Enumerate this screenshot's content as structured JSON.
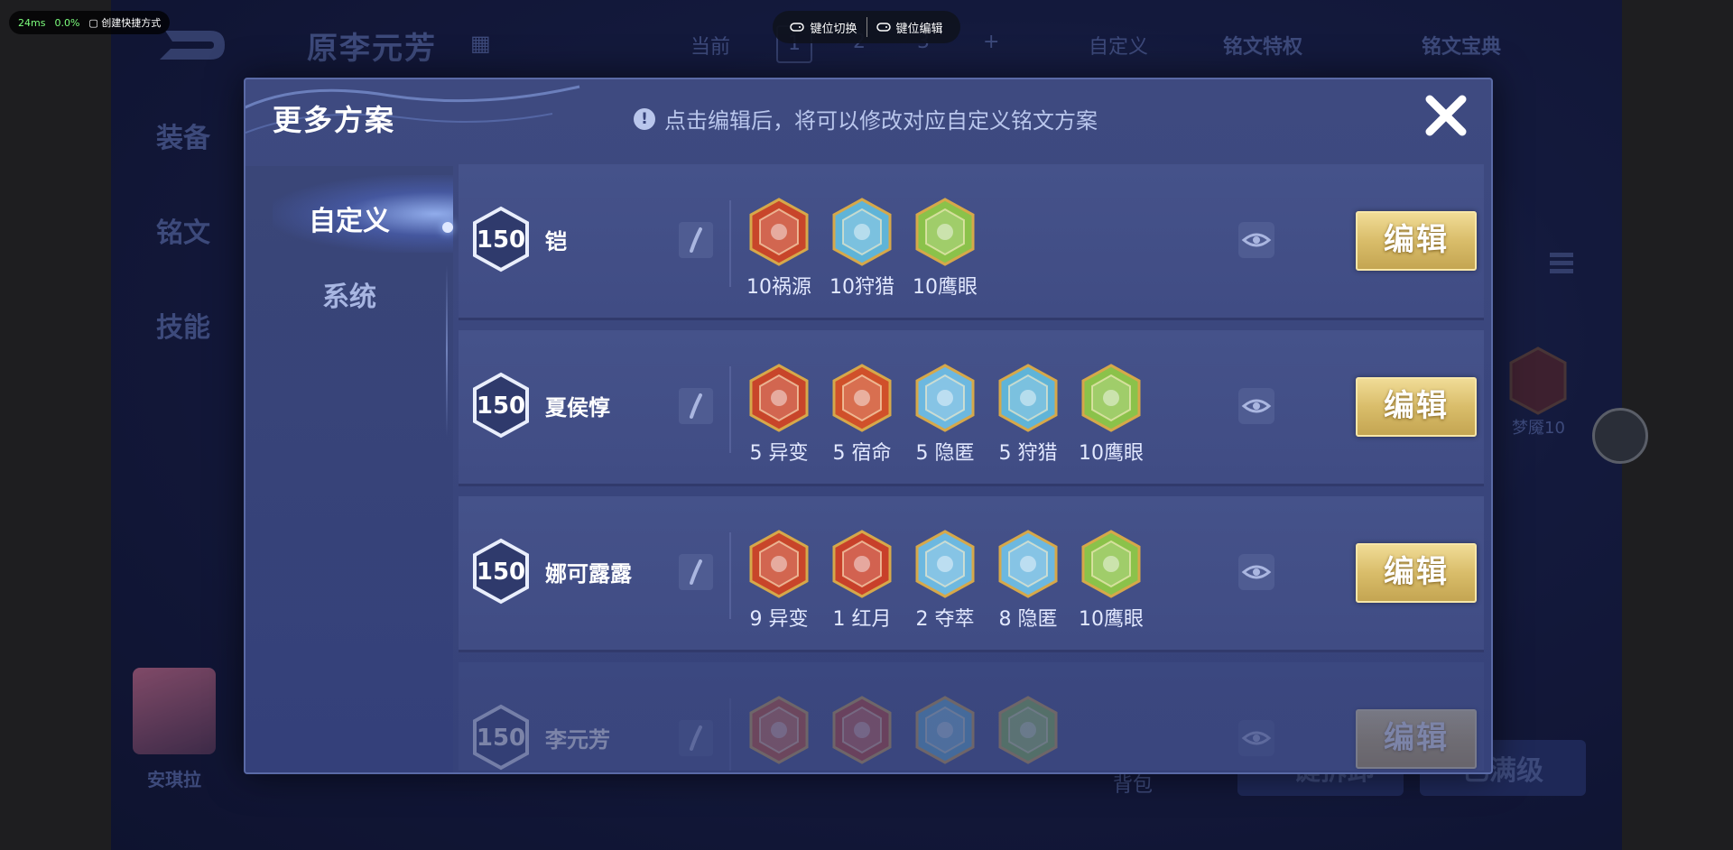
{
  "overlay": {
    "latency": "24ms",
    "cpu": "0.0%",
    "shortcut_label": "创建快捷方式",
    "key_switch": "键位切换",
    "key_edit": "键位编辑"
  },
  "background": {
    "hero_name": "原李元芳",
    "top_current": "当前",
    "top_tabs": [
      "1",
      "2",
      "3",
      "+"
    ],
    "top_custom": "自定义",
    "top_privilege": "铭文特权",
    "top_codex": "铭文宝典",
    "side_tabs": [
      "装备",
      "铭文",
      "技能"
    ],
    "bottom_name": "安琪拉",
    "bag": "背包",
    "btn_one_click": "一键拆卸",
    "btn_max": "已满级",
    "rune_label": "梦魇10"
  },
  "dialog": {
    "title": "更多方案",
    "hint": "点击编辑后，将可以修改对应自定义铭文方案",
    "nav": [
      "自定义",
      "系统"
    ],
    "edit_label": "编辑",
    "plans": [
      {
        "level": "150",
        "name": "铠",
        "runes": [
          {
            "label": "10祸源",
            "icon": "rune-red-claw",
            "color": "#c8452a"
          },
          {
            "label": "10狩猎",
            "icon": "rune-blue-lightning",
            "color": "#5fb4d8"
          },
          {
            "label": "10鹰眼",
            "icon": "rune-green-clover",
            "color": "#8bc24a"
          }
        ]
      },
      {
        "level": "150",
        "name": "夏侯惇",
        "runes": [
          {
            "label": "5 异变",
            "icon": "rune-red-gate",
            "color": "#c8452a"
          },
          {
            "label": "5 宿命",
            "icon": "rune-red-flame",
            "color": "#d0502a"
          },
          {
            "label": "5 隐匿",
            "icon": "rune-blue-drop",
            "color": "#6cb8e0"
          },
          {
            "label": "5 狩猎",
            "icon": "rune-blue-lightning",
            "color": "#5fb4d8"
          },
          {
            "label": "10鹰眼",
            "icon": "rune-green-clover",
            "color": "#8bc24a"
          }
        ]
      },
      {
        "level": "150",
        "name": "娜可露露",
        "runes": [
          {
            "label": "9 异变",
            "icon": "rune-red-gate",
            "color": "#c8452a"
          },
          {
            "label": "1 红月",
            "icon": "rune-red-moon",
            "color": "#c8402a"
          },
          {
            "label": "2 夺萃",
            "icon": "rune-blue-knot",
            "color": "#6cb8e0"
          },
          {
            "label": "8 隐匿",
            "icon": "rune-blue-drop",
            "color": "#6cb8e0"
          },
          {
            "label": "10鹰眼",
            "icon": "rune-green-clover",
            "color": "#8bc24a"
          }
        ]
      },
      {
        "level": "150",
        "name": "李元芳",
        "runes": [
          {
            "label": "",
            "icon": "rune-red-flame",
            "color": "#d0502a"
          },
          {
            "label": "",
            "icon": "rune-red-moon",
            "color": "#c8402a"
          },
          {
            "label": "",
            "icon": "rune-blue-lightning",
            "color": "#5fb4d8"
          },
          {
            "label": "",
            "icon": "rune-green-clover",
            "color": "#8bc24a"
          }
        ]
      }
    ]
  }
}
